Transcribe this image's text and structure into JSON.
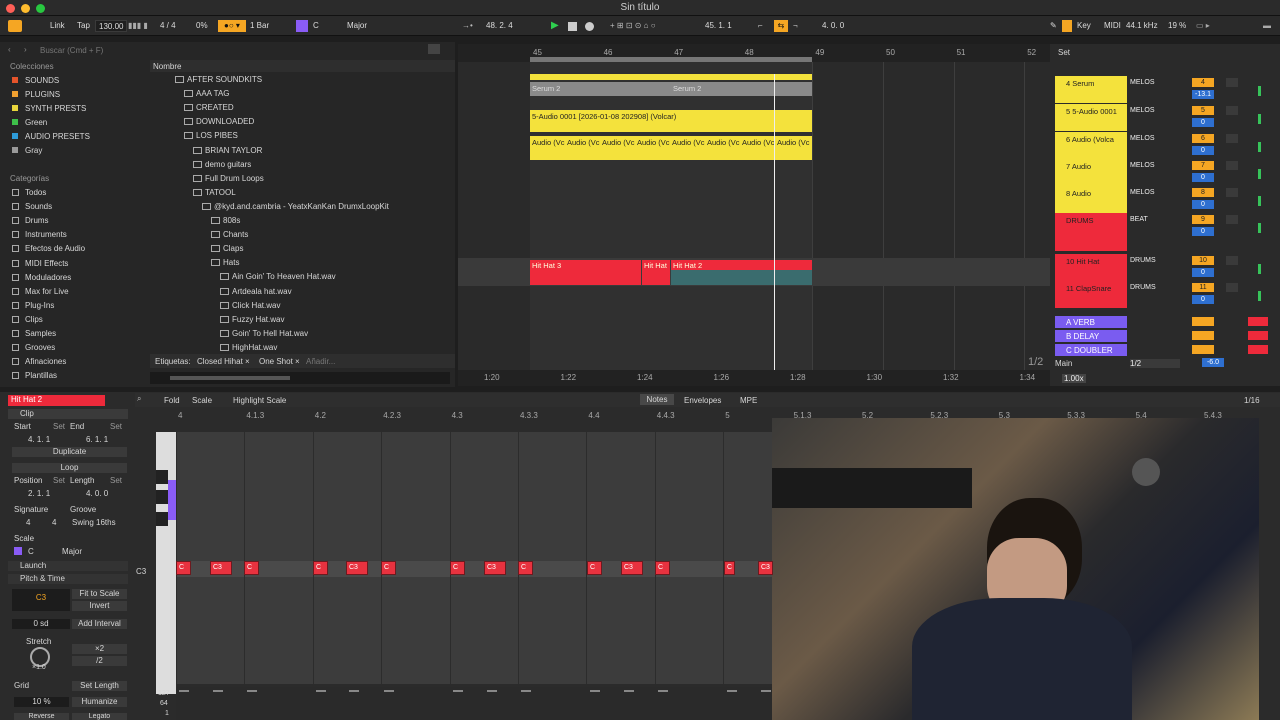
{
  "window": {
    "title": "Sin título"
  },
  "control_bar": {
    "link": "Link",
    "tap": "Tap",
    "tempo": "130.00",
    "meter": "4 / 4",
    "cpu_pct": "0%",
    "quantize": "1 Bar",
    "key_root": "C",
    "key_scale": "Major",
    "position": "48.   2.   4",
    "loop_start": "45.   1.   1",
    "loop_length": "4.   0.   0",
    "key": "Key",
    "midi": "MIDI",
    "sample_rate": "44.1 kHz",
    "cpu": "19 %"
  },
  "browser": {
    "search_placeholder": "Buscar (Cmd + F)",
    "collections_header": "Colecciones",
    "collections": [
      {
        "label": "SOUNDS",
        "color": "#e5542b"
      },
      {
        "label": "PLUGINS",
        "color": "#f0a030"
      },
      {
        "label": "SYNTH PRESTS",
        "color": "#e8d53c"
      },
      {
        "label": "Green",
        "color": "#3ec04a"
      },
      {
        "label": "AUDIO PRESETS",
        "color": "#2e9bd9"
      },
      {
        "label": "Gray",
        "color": "#9a9a9a"
      }
    ],
    "categories_header": "Categorías",
    "categories": [
      "Todos",
      "Sounds",
      "Drums",
      "Instruments",
      "Efectos de Audio",
      "MIDI Effects",
      "Moduladores",
      "Max for Live",
      "Plug-Ins",
      "Clips",
      "Samples",
      "Grooves",
      "Afinaciones",
      "Plantillas"
    ],
    "name_header": "Nombre",
    "tree": [
      "AFTER SOUNDKITS",
      "AAA TAG",
      "CREATED",
      "DOWNLOADED",
      "LOS PIBES",
      "BRIAN TAYLOR",
      "demo guitars",
      "Full Drum Loops",
      "TATOOL",
      "@kyd.and.cambria - YeatxKanKan DrumxLoopKit",
      "808s",
      "Chants",
      "Claps",
      "Hats",
      "Ain Goin' To Heaven Hat.wav",
      "Artdeala hat.wav",
      "Click Hat.wav",
      "Fuzzy Hat.wav",
      "Goin' To Hell Hat.wav",
      "HighHat.wav"
    ],
    "tags_label": "Etiquetas:",
    "tags": [
      "Closed Hihat ×",
      "One Shot ×"
    ],
    "tags_add": "Añadir..."
  },
  "arrangement": {
    "bar_numbers": [
      "45",
      "46",
      "47",
      "48",
      "49",
      "50",
      "51",
      "52"
    ],
    "time_labels": [
      "1:20",
      "1:22",
      "1:24",
      "1:26",
      "1:28",
      "1:30",
      "1:32",
      "1:34"
    ],
    "fraction": "1/2",
    "clips": {
      "serum1": "Serum 2",
      "serum2": "Serum 2",
      "audio_long": "5-Audio 0001 [2026-01-08 202908] (Volcar)",
      "audio_small": [
        "Audio (Vc",
        "Audio (Vc",
        "Audio (Vc",
        "Audio (Vc",
        "Audio (Vc",
        "Audio (Vc",
        "Audio (Vc",
        "Audio (Vc"
      ],
      "hat3": "Hit Hat 3",
      "hat_mid": "Hit Hat",
      "hat2": "Hit Hat 2"
    }
  },
  "mixer": {
    "set_label": "Set",
    "tracks": [
      {
        "name": "4 Serum",
        "route": "MELOS",
        "num": "4",
        "val": "-13.1",
        "color": "#f4e23c"
      },
      {
        "name": "5 5-Audio 0001",
        "route": "MELOS",
        "num": "5",
        "val": "0",
        "color": "#f4e23c"
      },
      {
        "name": "6 Audio (Volca",
        "route": "MELOS",
        "num": "6",
        "val": "0",
        "color": "#f4e23c"
      },
      {
        "name": "7 Audio",
        "route": "MELOS",
        "num": "7",
        "val": "0",
        "color": "#f4e23c"
      },
      {
        "name": "8 Audio",
        "route": "MELOS",
        "num": "8",
        "val": "0",
        "color": "#f4e23c"
      },
      {
        "name": "DRUMS",
        "route": "BEAT",
        "num": "9",
        "val": "0",
        "color": "#ee2a3b"
      },
      {
        "name": "10 Hit Hat",
        "route": "DRUMS",
        "num": "10",
        "val": "0",
        "color": "#ee2a3b"
      },
      {
        "name": "11 ClapSnare",
        "route": "DRUMS",
        "num": "11",
        "val": "0",
        "color": "#ee2a3b"
      }
    ],
    "returns": [
      "A VERB",
      "B DELAY",
      "C DOUBLER"
    ],
    "main": "Main",
    "main_route": "1/2",
    "main_val": "-6.0",
    "zoom": "1.00x"
  },
  "clip_view": {
    "clip_name": "Hit Hat 2",
    "tab_clip": "Clip",
    "start_label": "Start",
    "end_label": "End",
    "set": "Set",
    "start_val": "4.   1.   1",
    "end_val": "6.   1.   1",
    "duplicate": "Duplicate",
    "loop": "Loop",
    "position_label": "Position",
    "length_label": "Length",
    "position_val": "2.   1.   1",
    "length_val": "4.   0.   0",
    "signature_label": "Signature",
    "groove_label": "Groove",
    "sig_num": "4",
    "sig_den": "4",
    "groove_val": "Swing 16ths",
    "scale_label": "Scale",
    "scale_root": "C",
    "scale_name": "Major",
    "launch": "Launch",
    "pitch_time": "Pitch & Time",
    "pitch_note": "C3",
    "fit_to_scale": "Fit to Scale",
    "invert": "Invert",
    "zero_sd": "0 sd",
    "add_interval": "Add Interval",
    "stretch": "Stretch",
    "x2": "×2",
    "half": "/2",
    "stretch_val": "×1.0",
    "grid": "Grid",
    "set_length": "Set Length",
    "pct": "10 %",
    "humanize": "Humanize",
    "reverse": "Reverse",
    "legato": "Legato"
  },
  "editor": {
    "fold": "Fold",
    "scale": "Scale",
    "highlight_scale": "Highlight Scale",
    "tabs": [
      "Notes",
      "Envelopes",
      "MPE"
    ],
    "grid_frac": "1/16",
    "ruler": [
      "4",
      "4.1.3",
      "4.2",
      "4.2.3",
      "4.3",
      "4.3.3",
      "4.4",
      "4.4.3",
      "5",
      "5.1.3",
      "5.2",
      "5.2.3",
      "5.3",
      "5.3.3",
      "5.4",
      "5.4.3"
    ],
    "key_label": "C3",
    "velocity_labels": [
      "127",
      "64",
      "1"
    ],
    "notes": [
      "C",
      "C3",
      "C",
      "C",
      "C3",
      "C",
      "C",
      "C3",
      "C",
      "C",
      "C3",
      "C",
      "C",
      "C3"
    ]
  }
}
